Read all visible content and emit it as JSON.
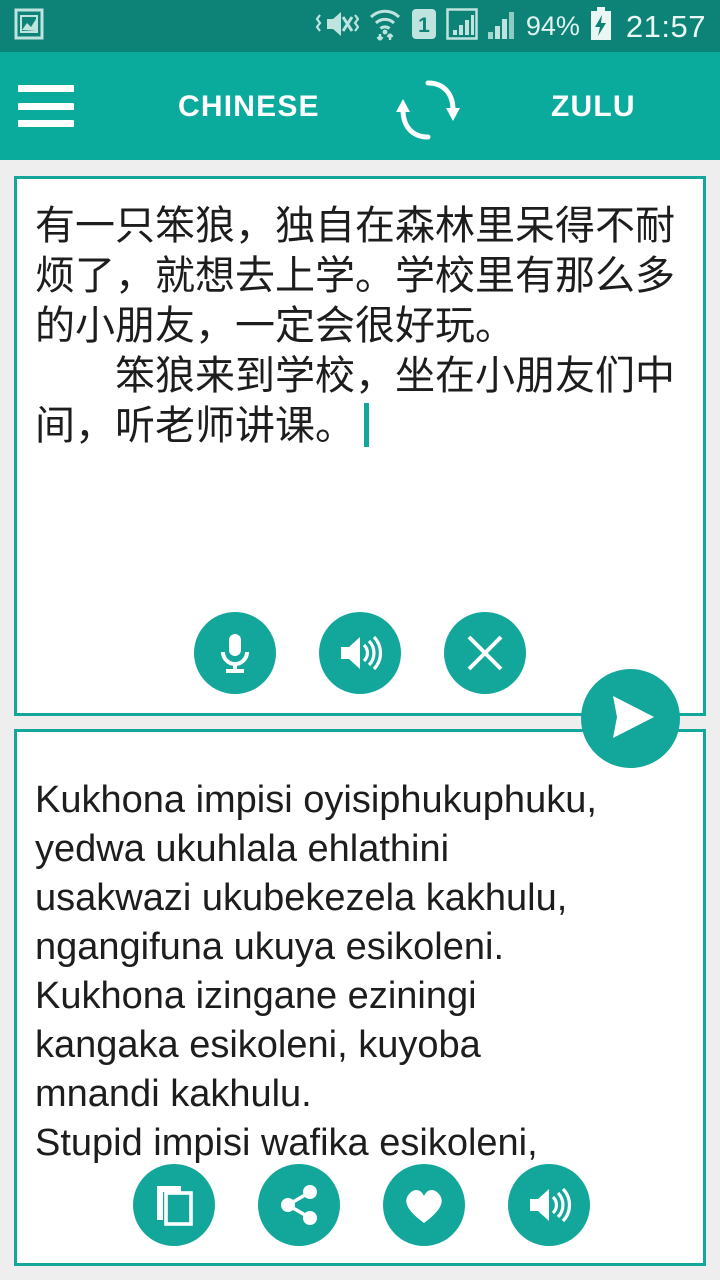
{
  "status_bar": {
    "screenshot_icon": "picture-icon",
    "mute_icon": "vibrate-mute-icon",
    "wifi_icon": "wifi-transfer-icon",
    "sim_icon": "sim-1-icon",
    "signal1_icon": "signal-boxed-icon",
    "signal2_icon": "signal-bars-icon",
    "battery_percent": "94%",
    "battery_icon": "battery-charging-icon",
    "clock": "21:57"
  },
  "app_bar": {
    "menu_icon": "hamburger-menu-icon",
    "source_language": "CHINESE",
    "swap_icon": "swap-languages-icon",
    "target_language": "ZULU"
  },
  "source_panel": {
    "text": "有一只笨狼，独自在森林里呆得不耐烦了，就想去上学。学校里有那么多的小朋友，一定会很好玩。\n　　笨狼来到学校，坐在小朋友们中间，听老师讲课。",
    "has_caret": true,
    "actions": [
      {
        "name": "mic-button",
        "icon": "microphone-icon",
        "label": "Speak"
      },
      {
        "name": "speak-source-button",
        "icon": "speaker-icon",
        "label": "Listen"
      },
      {
        "name": "clear-button",
        "icon": "close-icon",
        "label": "Clear"
      }
    ],
    "send": {
      "name": "send-button",
      "icon": "send-paper-plane-icon",
      "label": "Translate"
    }
  },
  "target_panel": {
    "text": "Kukhona impisi oyisiphukuphuku,\nyedwa ukuhlala ehlathini\nusakwazi ukubekezela kakhulu,\nngangifuna ukuya esikoleni.\nKukhona izingane eziningi\nkangaka esikoleni, kuyoba\nmnandi kakhulu.\nStupid impisi wafika esikoleni,",
    "actions": [
      {
        "name": "copy-button",
        "icon": "copy-icon",
        "label": "Copy"
      },
      {
        "name": "share-button",
        "icon": "share-icon",
        "label": "Share"
      },
      {
        "name": "favorite-button",
        "icon": "heart-icon",
        "label": "Favorite"
      },
      {
        "name": "speak-target-button",
        "icon": "speaker-icon",
        "label": "Listen"
      }
    ]
  },
  "colors": {
    "status_bar": "#0d8377",
    "app_bar": "#0aab9c",
    "accent": "#12a79a",
    "page_background": "#eeeeee",
    "card_background": "#ffffff",
    "text": "#1d1d1d"
  }
}
